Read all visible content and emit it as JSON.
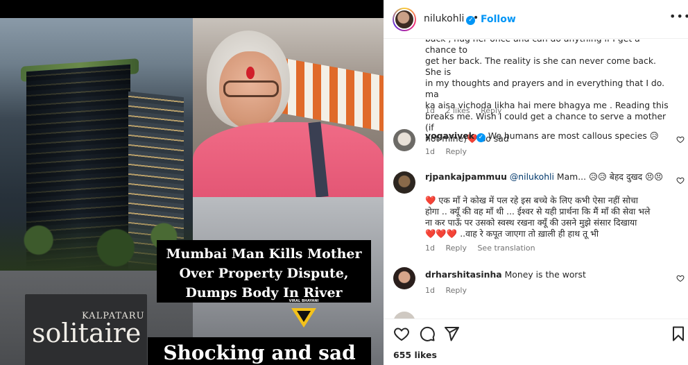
{
  "post": {
    "headline_lines": [
      "Mumbai Man Kills Mother",
      "Over Property Dispute,",
      "Dumps Body In River"
    ],
    "sign_small": "KALPATARU",
    "sign_big": "solitaire",
    "logo_text": "VIRAL BHAYANI",
    "logo_letter": "V",
    "shock_text": "Shocking and sad"
  },
  "header": {
    "username": "nilukohli",
    "separator": "•",
    "follow_label": "Follow",
    "more_icon": "more-horizontal-icon",
    "verified_icon": "verified-badge-icon"
  },
  "comments": {
    "first": {
      "lines": [
        "back , hug her once and can do anything if I get a chance to",
        "get her back. The reality is she can never come back. She is",
        "in my thoughts and prayers and in everything that I do. ma",
        "ka aisa vichoda likha hai mere bhagya me . Reading this",
        "breaks me. Wish I could get a chance to serve a mother (if",
        "not mine)"
      ],
      "emoji": "❤️",
      "tail": " So sad",
      "time": "1d",
      "likes": "2 likes",
      "reply": "Reply"
    },
    "items": [
      {
        "username": "yogavivek",
        "verified": true,
        "text": "We humans are most callous species 😥",
        "time": "1d",
        "reply": "Reply"
      },
      {
        "username": "rjpankajpammuu",
        "mention": "@nilukohli",
        "text_inline": " Mam... 😥😥 बेहद दुखद 😣😣",
        "lines": [
          "❤️ एक माँ ने कोख में पल रहे इस बच्चे के लिए कभी ऐसा नहीं सोचा",
          "होगा .. क्यूँ की वह माँ थी ... ईश्वर से यही प्रार्थना कि मैं माँ की सेवा भले",
          "ना कर पाऊँ पर उसको स्वस्थ रखना क्यूँ की उसने मुझे संसार दिखाया",
          "❤️❤️❤️ ..वाह रे कपूत जाएगा तो ख़ाली ही हाथ तू भी"
        ],
        "time": "1d",
        "reply": "Reply",
        "translate": "See translation"
      },
      {
        "username": "drharshitasinha",
        "text": "Money is the worst",
        "time": "1d",
        "reply": "Reply"
      }
    ]
  },
  "actions": {
    "icons": [
      "heart-icon",
      "comment-icon",
      "share-icon",
      "bookmark-icon"
    ],
    "likes": "655 likes"
  },
  "colors": {
    "accent": "#0095f6",
    "text": "#262626",
    "muted": "#737373",
    "mention": "#00376b"
  }
}
